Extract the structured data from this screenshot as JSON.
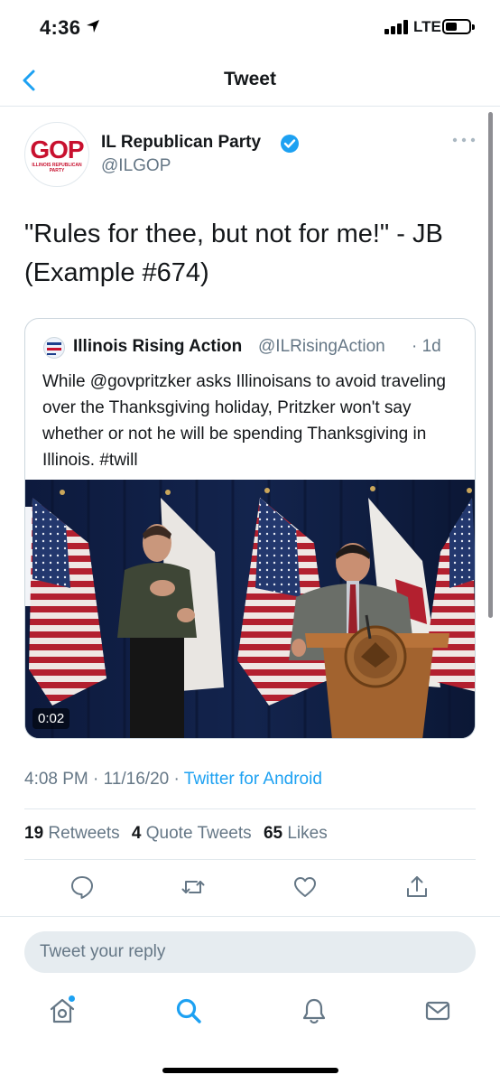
{
  "status_bar": {
    "time": "4:36",
    "network": "LTE"
  },
  "header": {
    "title": "Tweet"
  },
  "tweet": {
    "author_name": "IL Republican Party",
    "author_handle": "@ILGOP",
    "avatar_logo_text": "GOP",
    "avatar_logo_subtext": "ILLINOIS REPUBLICAN PARTY",
    "text_line1": "\"Rules for thee, but not for me!\" - JB",
    "text_line2": "(Example #674)",
    "time": "4:08 PM",
    "date": "11/16/20",
    "source": "Twitter for Android",
    "retweets_count": "19",
    "retweets_label": "Retweets",
    "quote_count": "4",
    "quote_label": "Quote Tweets",
    "likes_count": "65",
    "likes_label": "Likes"
  },
  "quoted_tweet": {
    "author_name": "Illinois Rising Action",
    "author_handle": "@ILRisingAction",
    "age": "1d",
    "text": "While @govpritzker asks Illinoisans to avoid traveling over the Thanksgiving holiday, Pritzker won't say whether or not he will be spending Thanksgiving in Illinois. #twill",
    "video_duration": "0:02"
  },
  "reply": {
    "placeholder": "Tweet your reply"
  },
  "icons": {
    "back": "chevron-left-icon",
    "more": "ellipsis-icon",
    "verified": "verified-badge-icon",
    "reply": "comment-icon",
    "retweet": "retweet-icon",
    "like": "heart-icon",
    "share": "share-icon",
    "home": "home-icon",
    "search": "search-icon",
    "notifications": "bell-icon",
    "messages": "mail-icon"
  },
  "colors": {
    "accent": "#1da1f2",
    "secondary_text": "#657786",
    "divider": "#e1e8ed",
    "gop_red": "#c8102e"
  }
}
